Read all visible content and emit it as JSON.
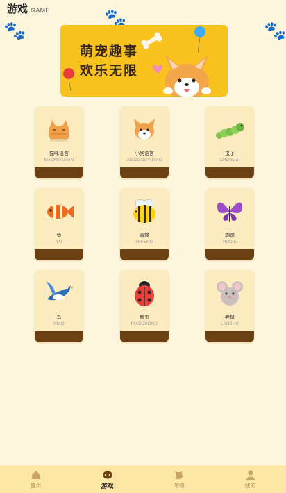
{
  "header": {
    "title_cn": "游戏",
    "title_en": "GAME"
  },
  "banner": {
    "line1": "萌宠趣事",
    "line2": "欢乐无限"
  },
  "cards": [
    {
      "name": "猫咪语言",
      "pinyin": "MAOMIYUYAN",
      "icon": "cat-icon"
    },
    {
      "name": "小狗语言",
      "pinyin": "XIAOGOUYUYAN",
      "icon": "dog-icon"
    },
    {
      "name": "虫子",
      "pinyin": "CHONGZI",
      "icon": "caterpillar-icon"
    },
    {
      "name": "鱼",
      "pinyin": "YU",
      "icon": "fish-icon"
    },
    {
      "name": "蜜蜂",
      "pinyin": "MIFENG",
      "icon": "bee-icon"
    },
    {
      "name": "蝴蝶",
      "pinyin": "HUDIE",
      "icon": "butterfly-icon"
    },
    {
      "name": "鸟",
      "pinyin": "NIAO",
      "icon": "bird-icon"
    },
    {
      "name": "瓢虫",
      "pinyin": "PIAOCHONG",
      "icon": "ladybug-icon"
    },
    {
      "name": "老鼠",
      "pinyin": "LAOSHU",
      "icon": "mouse-icon"
    }
  ],
  "tabs": [
    {
      "label": "首页",
      "icon": "home-icon"
    },
    {
      "label": "游戏",
      "icon": "game-icon",
      "active": true
    },
    {
      "label": "宠物",
      "icon": "pet-icon"
    },
    {
      "label": "我的",
      "icon": "profile-icon"
    }
  ],
  "colors": {
    "background": "#fdf5dc",
    "banner": "#f9c21f",
    "card": "#fdebc0",
    "card_footer": "#6b4113",
    "tabbar": "#fde7a4"
  }
}
